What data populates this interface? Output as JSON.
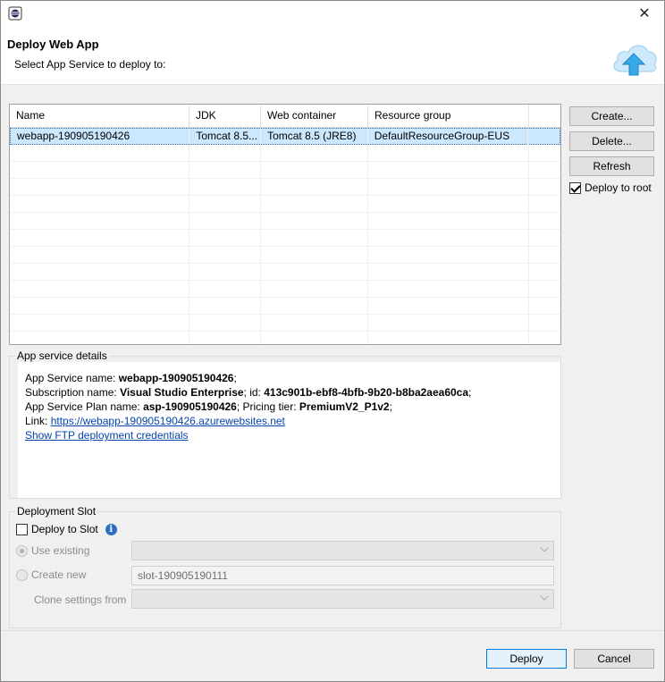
{
  "dialog": {
    "title": "Deploy Web App",
    "subtitle": "Select App Service to deploy to:",
    "close_glyph": "✕",
    "app_icon": "eclipse-app-icon",
    "header_icon": "cloud-upload-icon"
  },
  "table": {
    "columns": [
      "Name",
      "JDK",
      "Web container",
      "Resource group"
    ],
    "rows": [
      {
        "name": "webapp-190905190426",
        "jdk": "Tomcat 8.5...",
        "container": "Tomcat 8.5 (JRE8)",
        "resource_group": "DefaultResourceGroup-EUS"
      }
    ]
  },
  "buttons": {
    "create": "Create...",
    "delete": "Delete...",
    "refresh": "Refresh",
    "deploy": "Deploy",
    "cancel": "Cancel"
  },
  "deploy_to_root": {
    "label": "Deploy to root",
    "checked": true
  },
  "details": {
    "group_label": "App service details",
    "app_service_name_label": "App Service name: ",
    "app_service_name": "webapp-190905190426",
    "app_service_name_suffix": ";",
    "subscription_label": "Subscription name: ",
    "subscription_name": "Visual Studio Enterprise",
    "id_label": "; id: ",
    "subscription_id": "413c901b-ebf8-4bfb-9b20-b8ba2aea60ca",
    "id_suffix": ";",
    "plan_label": "App Service Plan name: ",
    "plan_name": "asp-190905190426",
    "tier_label": "; Pricing tier: ",
    "pricing_tier": "PremiumV2_P1v2",
    "tier_suffix": ";",
    "link_label": "Link: ",
    "link_url": "https://webapp-190905190426.azurewebsites.net",
    "ftp_link": "Show FTP deployment credentials"
  },
  "slot": {
    "group_label": "Deployment Slot",
    "deploy_to_slot": "Deploy to Slot",
    "deploy_to_slot_checked": false,
    "use_existing": "Use existing",
    "create_new": "Create new",
    "new_slot_name": "slot-190905190111",
    "clone_settings": "Clone settings from",
    "info_glyph": "i"
  },
  "colors": {
    "selection": "#cce8ff",
    "link": "#0645ad",
    "cloud": "#38a8e8"
  }
}
